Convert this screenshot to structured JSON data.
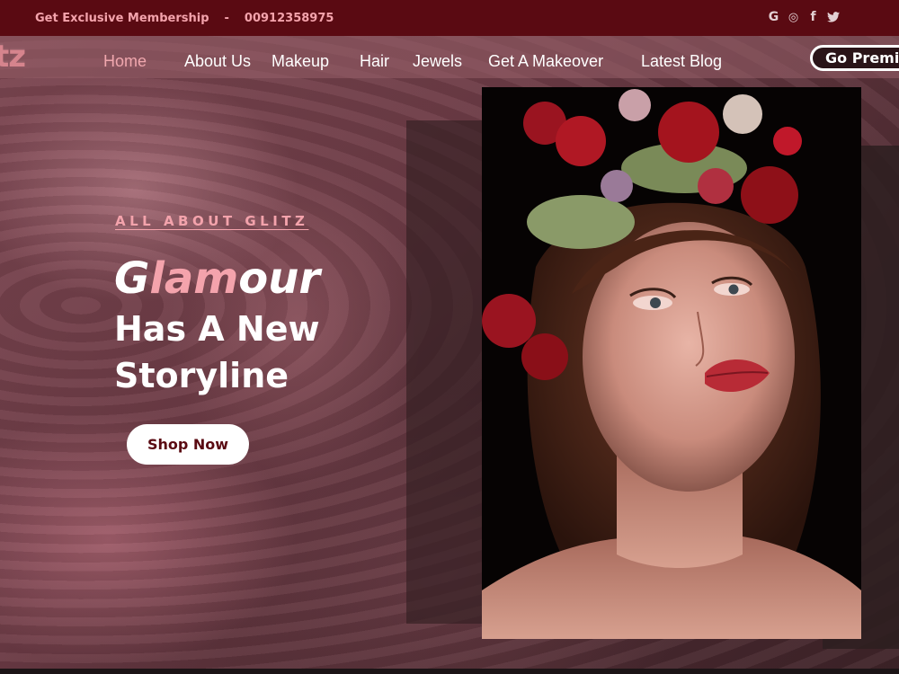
{
  "topbar": {
    "promo": "Get Exclusive Membership",
    "separator": "-",
    "phone": "00912358975",
    "socials": [
      {
        "icon": "google-icon",
        "glyph": "G"
      },
      {
        "icon": "instagram-icon",
        "glyph": "◎"
      },
      {
        "icon": "facebook-icon",
        "glyph": "f"
      },
      {
        "icon": "twitter-icon",
        "glyph": "🐦"
      }
    ]
  },
  "nav": {
    "logo": "tz",
    "logo_shadow": "tz",
    "items": [
      {
        "label": "Home",
        "active": true
      },
      {
        "label": "About Us"
      },
      {
        "label": "Makeup"
      },
      {
        "label": "Hair"
      },
      {
        "label": "Jewels"
      },
      {
        "label": "Get A Makeover"
      },
      {
        "label": "Latest Blog"
      }
    ],
    "premium_label": "Go Premium"
  },
  "hero": {
    "eyebrow": "ALL ABOUT GLITZ",
    "headline_g": "G",
    "headline_pink": "lam",
    "headline_rest": "our",
    "headline_line2": "Has A New",
    "headline_line3": "Storyline",
    "cta": "Shop Now"
  },
  "colors": {
    "topbar": "#5a0a12",
    "accent_pink": "#f4a3ac",
    "nav_bg": "#96656b"
  }
}
